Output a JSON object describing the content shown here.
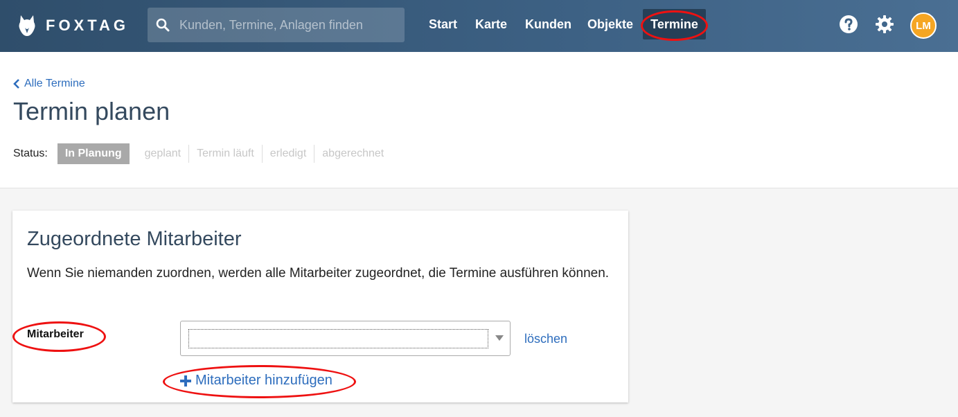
{
  "brand": {
    "name": "FOXTAG"
  },
  "search": {
    "placeholder": "Kunden, Termine, Anlagen finden"
  },
  "nav": {
    "items": [
      {
        "label": "Start"
      },
      {
        "label": "Karte"
      },
      {
        "label": "Kunden"
      },
      {
        "label": "Objekte"
      },
      {
        "label": "Termine",
        "active": true
      }
    ]
  },
  "user": {
    "initials": "LM"
  },
  "header": {
    "back_label": "Alle Termine",
    "title": "Termin planen",
    "status_label": "Status:",
    "status_steps": [
      "In Planung",
      "geplant",
      "Termin läuft",
      "erledigt",
      "abgerechnet"
    ],
    "current_status": "In Planung"
  },
  "card": {
    "title": "Zugeordnete Mitarbeiter",
    "description": "Wenn Sie niemanden zuordnen, werden alle Mitarbeiter zugeordnet, die Termine ausführen können.",
    "field_label": "Mitarbeiter",
    "select_value": "",
    "delete_label": "löschen",
    "add_label": "Mitarbeiter hinzufügen"
  },
  "colors": {
    "nav_bg": "#3d6184",
    "link": "#2d6dbd",
    "title": "#34495e",
    "status_current": "#a9a9a9",
    "avatar": "#f5a623",
    "annotation": "#e11111"
  }
}
